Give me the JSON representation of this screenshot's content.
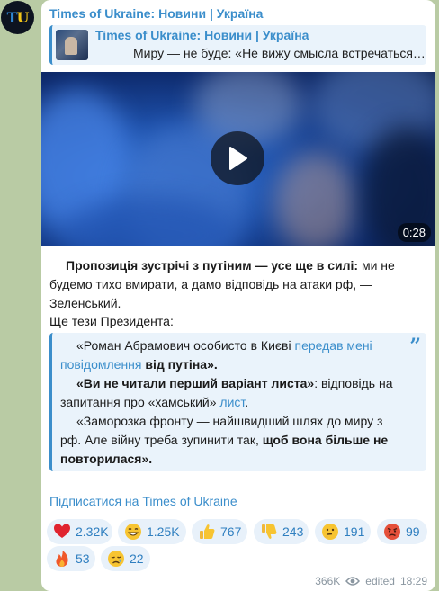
{
  "channel": {
    "name": "Times of Ukraine: Новини | Україна",
    "avatar_text_1": "T",
    "avatar_text_2": "U"
  },
  "reply": {
    "title": "Times of Ukraine: Новини | Україна",
    "text": "Миру — не буде: «Не вижу смысла встречаться …"
  },
  "video": {
    "duration": "0:28"
  },
  "post": {
    "p1_bold": "Пропозиція зустрічі з путіним — усе ще в силі:",
    "p1_rest": " ми не будемо тихо вмирати, а дамо відповідь на атаки рф, — Зеленський.",
    "p2": "Ще тези Президента:"
  },
  "quote": {
    "l1_a": "«Роман Абрамович особисто в Києві ",
    "l1_link": "передав мені повідомлення",
    "l1_b": " від путіна».",
    "l2_bold": "«Ви не читали перший варіант листа»",
    "l2_a": ": відповідь на запитання про «хамський» ",
    "l2_link": "лист",
    "l2_b": ".",
    "l3_a": "«Заморозка фронту — найшвидший шлях до миру з рф. Але війну треба зупинити так, ",
    "l3_bold": "щоб вона більше не повторилася»",
    "l3_b": ".",
    "mark": "”"
  },
  "subscribe": "Підписатися на Times of Ukraine",
  "reactions": [
    {
      "icon": "red-heart-icon",
      "count": "2.32K"
    },
    {
      "icon": "grinning-face-icon",
      "count": "1.25K"
    },
    {
      "icon": "thumbs-up-icon",
      "count": "767"
    },
    {
      "icon": "thumbs-down-icon",
      "count": "243"
    },
    {
      "icon": "thinking-face-icon",
      "count": "191"
    },
    {
      "icon": "angry-face-icon",
      "count": "99"
    },
    {
      "icon": "fire-icon",
      "count": "53"
    },
    {
      "icon": "crying-face-icon",
      "count": "22"
    }
  ],
  "footer": {
    "views": "366K",
    "edited": "edited",
    "time": "18:29"
  },
  "colors": {
    "accent": "#3b8ecb",
    "background": "#b9cba4",
    "quote_bg": "#eaf3fb"
  }
}
